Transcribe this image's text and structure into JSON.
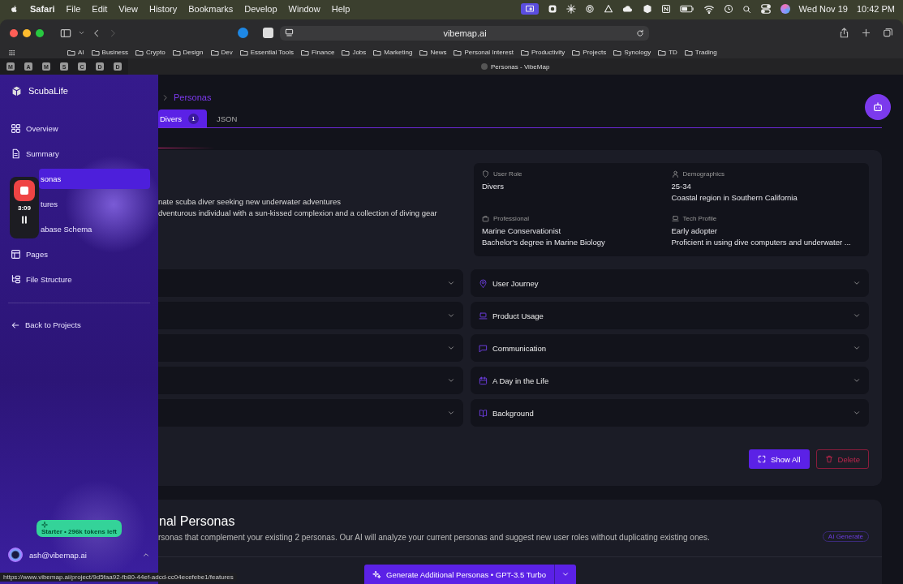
{
  "menubar": {
    "app": "Safari",
    "menus": [
      "File",
      "Edit",
      "View",
      "History",
      "Bookmarks",
      "Develop",
      "Window",
      "Help"
    ],
    "date": "Wed Nov 19",
    "time": "10:42 PM"
  },
  "browser": {
    "address": "vibemap.ai",
    "bookmarks": [
      "AI",
      "Business",
      "Crypto",
      "Design",
      "Dev",
      "Essential Tools",
      "Finance",
      "Jobs",
      "Marketing",
      "News",
      "Personal Interest",
      "Productivity",
      "Projects",
      "Synology",
      "TD",
      "Trading"
    ],
    "pinned_tabs": [
      "M",
      "A",
      "M",
      "S",
      "C",
      "D",
      "D"
    ],
    "tab_title": "Personas - VibeMap",
    "status_url": "https://www.vibemap.ai/project/9d5faa92-fb80-44ef-adcd-cc04ecefebe1/features"
  },
  "sidebar": {
    "project": "ScubaLife",
    "items": [
      {
        "label": "Overview",
        "kind": "full",
        "selected": false
      },
      {
        "label": "Summary",
        "kind": "full",
        "selected": false
      },
      {
        "label": "sonas",
        "kind": "covered",
        "selected": true
      },
      {
        "label": "tures",
        "kind": "covered",
        "selected": false
      },
      {
        "label": "abase Schema",
        "kind": "covered",
        "selected": false
      },
      {
        "label": "Pages",
        "kind": "full",
        "selected": false
      },
      {
        "label": "File Structure",
        "kind": "full",
        "selected": false
      }
    ],
    "back": "Back to Projects",
    "plan": "Starter • 296k tokens left",
    "user": "ash@vibemap.ai"
  },
  "recorder": {
    "time": "3:09"
  },
  "main": {
    "breadcrumb": "Personas",
    "tabs": [
      {
        "label": "Divers",
        "count": "1",
        "selected": true
      },
      {
        "label": "JSON",
        "selected": false
      }
    ],
    "persona_lines": [
      "nate scuba diver seeking new underwater adventures",
      "dventurous individual with a sun-kissed complexion and a collection of diving gear"
    ],
    "info": [
      {
        "label": "User Role",
        "values": [
          "Divers"
        ]
      },
      {
        "label": "Demographics",
        "values": [
          "25-34",
          "Coastal region in Southern California"
        ]
      },
      {
        "label": "Professional",
        "values": [
          "Marine Conservationist",
          "Bachelor's degree in Marine Biology"
        ]
      },
      {
        "label": "Tech Profile",
        "values": [
          "Early adopter",
          "Proficient in using dive computers and underwater ..."
        ]
      }
    ],
    "left_sections": [
      {
        "expanded": false
      },
      {
        "expanded": false
      },
      {
        "expanded": false
      },
      {
        "expanded": false
      },
      {
        "expanded": false
      }
    ],
    "right_sections": [
      {
        "label": "User Journey",
        "expanded": false
      },
      {
        "label": "Product Usage",
        "expanded": false
      },
      {
        "label": "Communication",
        "expanded": false
      },
      {
        "label": "A Day in the Life",
        "expanded": false
      },
      {
        "label": "Background",
        "expanded": false
      }
    ],
    "actions": [
      {
        "label": "Show All",
        "kind": "primary"
      },
      {
        "label": "Delete",
        "kind": "danger"
      }
    ],
    "additional": {
      "title": "nal Personas",
      "description": "rsonas that complement your existing 2 personas. Our AI will analyze your current personas and suggest new user roles without duplicating existing ones.",
      "badge": "AI Generate"
    },
    "generate": "Generate Additional Personas • GPT-3.5 Turbo"
  }
}
